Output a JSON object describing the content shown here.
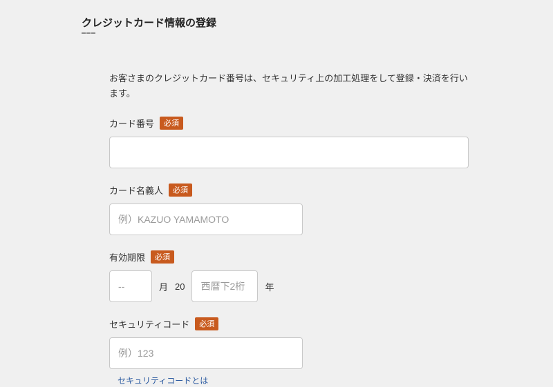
{
  "title": "クレジットカード情報の登録",
  "intro": "お客さまのクレジットカード番号は、セキュリティ上の加工処理をして登録・決済を行います。",
  "required_label": "必須",
  "fields": {
    "card_number": {
      "label": "カード番号"
    },
    "card_holder": {
      "label": "カード名義人",
      "placeholder": "例）KAZUO YAMAMOTO"
    },
    "expiry": {
      "label": "有効期限",
      "month_placeholder": "--",
      "month_suffix": "月",
      "year_prefix": "20",
      "year_placeholder": "西暦下2桁",
      "year_suffix": "年"
    },
    "cvv": {
      "label": "セキュリティコード",
      "placeholder": "例）123",
      "help_link": "セキュリティコードとは"
    }
  }
}
